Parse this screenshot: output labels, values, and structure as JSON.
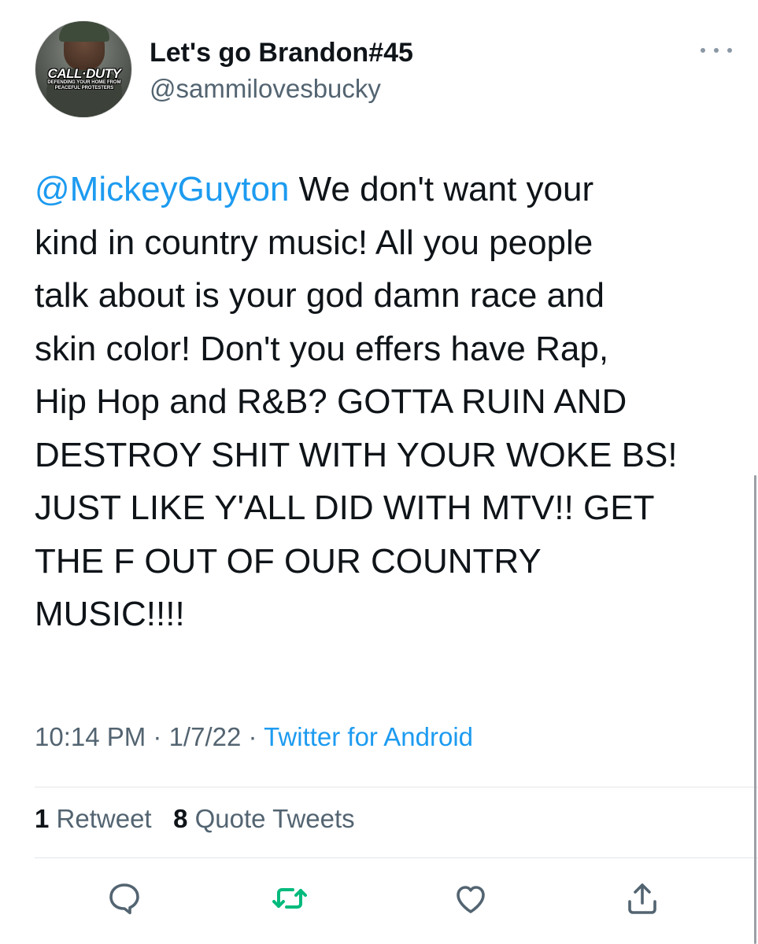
{
  "author": {
    "display_name": "Let's go Brandon#45",
    "handle": "@sammilovesbucky",
    "avatar_text": {
      "main": "CALL·DUTY",
      "sub1": "DEFENDING YOUR HOME FROM",
      "sub2": "PEACEFUL PROTESTERS"
    }
  },
  "tweet": {
    "mention": "@MickeyGuyton",
    "line1_rest": " We don't want your",
    "lines": [
      "kind in country music! All you people",
      "talk about is your god damn race and",
      "skin color! Don't you effers have Rap,",
      "Hip Hop and R&B? GOTTA RUIN AND",
      "DESTROY SHIT WITH YOUR WOKE BS!",
      "JUST LIKE Y'ALL DID WITH MTV!! GET",
      "THE F OUT OF OUR COUNTRY",
      "MUSIC!!!!"
    ]
  },
  "meta": {
    "time": "10:14 PM",
    "separator1": " · ",
    "date": "1/7/22",
    "separator2": " · ",
    "source": "Twitter for Android"
  },
  "stats": {
    "retweets_count": "1",
    "retweets_label": " Retweet",
    "quotes_count": "8",
    "quotes_label": " Quote Tweets"
  },
  "icons": {
    "reply": "reply-icon",
    "retweet": "retweet-icon",
    "like": "heart-icon",
    "share": "share-icon",
    "more": "more-icon"
  },
  "colors": {
    "link": "#1d9bf0",
    "secondary_text": "#536471",
    "retweet_icon": "#00ba7c"
  }
}
